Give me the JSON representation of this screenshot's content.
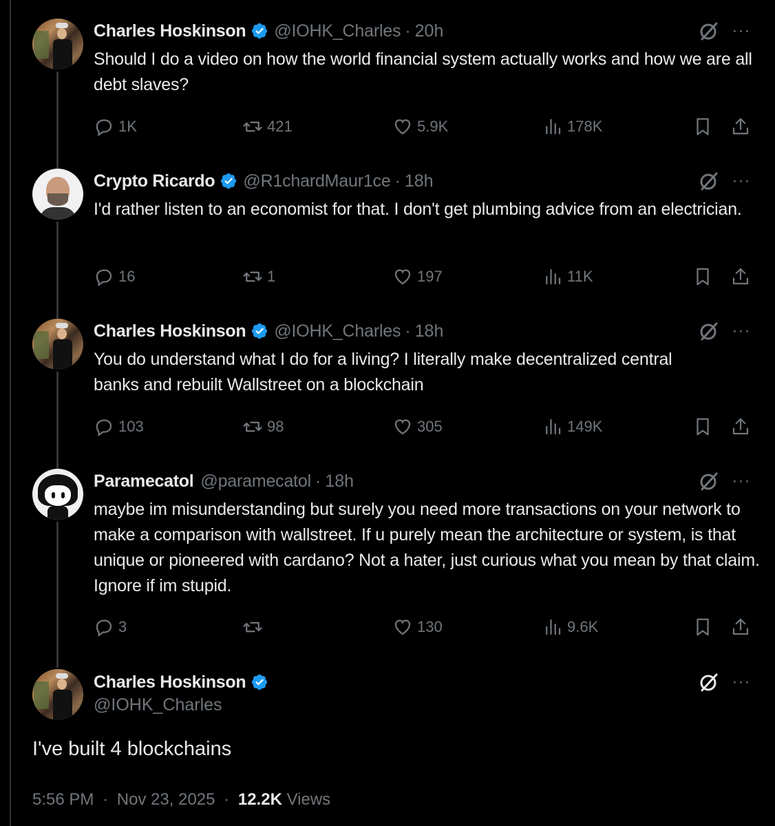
{
  "tweets": [
    {
      "name": "Charles Hoskinson",
      "handle": "@IOHK_Charles",
      "time": "20h",
      "text": "Should I do a video on how the world financial system actually works and how we are all debt slaves?",
      "replies": "1K",
      "reposts": "421",
      "likes": "5.9K",
      "views": "178K"
    },
    {
      "name": "Crypto Ricardo",
      "handle": "@R1chardMaur1ce",
      "time": "18h",
      "text": "I'd rather listen to an economist for that.  I don't get plumbing advice from an electrician.",
      "replies": "16",
      "reposts": "1",
      "likes": "197",
      "views": "11K"
    },
    {
      "name": "Charles Hoskinson",
      "handle": "@IOHK_Charles",
      "time": "18h",
      "text": "You do understand what I do for a living? I literally make decentralized central banks and rebuilt Wallstreet on a blockchain",
      "replies": "103",
      "reposts": "98",
      "likes": "305",
      "views": "149K"
    },
    {
      "name": "Paramecatol",
      "handle": "@paramecatol",
      "time": "18h",
      "text": "maybe im misunderstanding but surely you need more transactions on your network to make a comparison with wallstreet. If u purely mean the architecture or system, is that unique or pioneered with cardano? Not a hater, just curious what you mean by that claim. Ignore if im stupid.",
      "replies": "3",
      "reposts": "",
      "likes": "130",
      "views": "9.6K"
    }
  ],
  "focus": {
    "name": "Charles Hoskinson",
    "handle": "@IOHK_Charles",
    "text": "I've built 4 blockchains",
    "time": "5:56 PM",
    "date": "Nov 23, 2025",
    "views_count": "12.2K",
    "views_label": "Views"
  },
  "ui": {
    "dot": "·",
    "more": "···"
  },
  "colors": {
    "background": "#000000",
    "text": "#e7e9ea",
    "muted": "#71767b",
    "verified": "#1d9bf0"
  }
}
